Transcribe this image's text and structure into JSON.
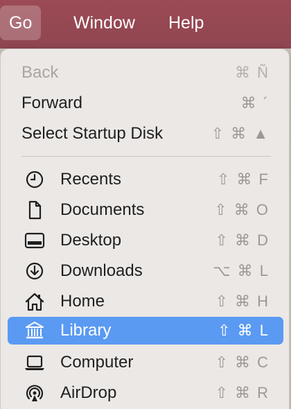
{
  "menubar": {
    "items": [
      {
        "label": "Go",
        "active": true
      },
      {
        "label": "Window"
      },
      {
        "label": "Help"
      }
    ]
  },
  "menu": {
    "items": [
      {
        "label": "Back",
        "shortcut": "⌘ Ñ",
        "disabled": true
      },
      {
        "label": "Forward",
        "shortcut": "⌘ ´"
      },
      {
        "label": "Select Startup Disk",
        "shortcut": "⇧ ⌘ ▲"
      },
      {
        "label": "Recents",
        "shortcut": "⇧ ⌘ F",
        "icon": "clock-icon"
      },
      {
        "label": "Documents",
        "shortcut": "⇧ ⌘ O",
        "icon": "document-icon"
      },
      {
        "label": "Desktop",
        "shortcut": "⇧ ⌘ D",
        "icon": "desktop-icon"
      },
      {
        "label": "Downloads",
        "shortcut": "⌥ ⌘ L",
        "icon": "download-icon"
      },
      {
        "label": "Home",
        "shortcut": "⇧ ⌘ H",
        "icon": "house-icon"
      },
      {
        "label": "Library",
        "shortcut": "⇧ ⌘ L",
        "icon": "library-icon",
        "highlighted": true
      },
      {
        "label": "Computer",
        "shortcut": "⇧ ⌘ C",
        "icon": "laptop-icon"
      },
      {
        "label": "AirDrop",
        "shortcut": "⇧ ⌘ R",
        "icon": "airdrop-icon"
      }
    ]
  },
  "colors": {
    "menubar": "#9c4a55",
    "highlight": "#5a9af2",
    "menu_bg": "#ebe8e6"
  }
}
